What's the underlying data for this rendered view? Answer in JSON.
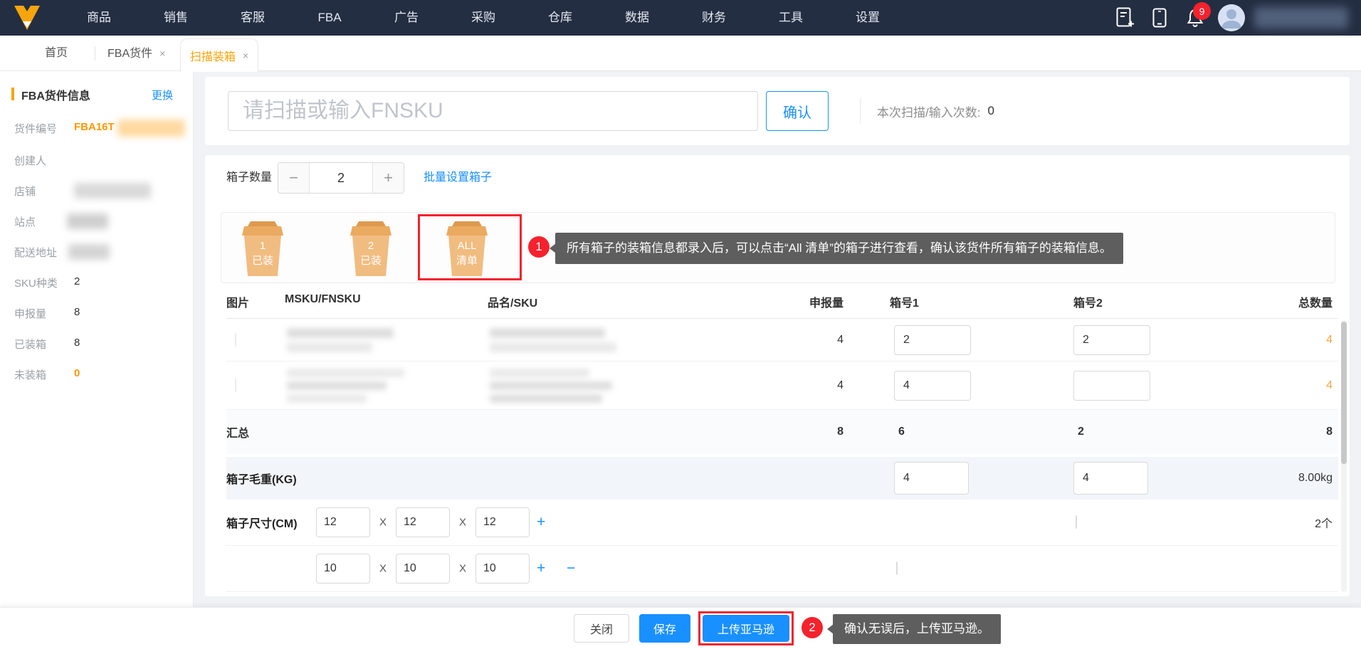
{
  "colors": {
    "accent_blue": "#1890ff",
    "brand_orange": "#f7a50d",
    "badge_red": "#f5222d",
    "navbar_bg": "#242e42",
    "tooltip_bg": "#5e5e5e"
  },
  "navbar": {
    "menu_items": [
      "商品",
      "销售",
      "客服",
      "FBA",
      "广告",
      "采购",
      "仓库",
      "数据",
      "财务",
      "工具",
      "设置"
    ],
    "notification_count": "9"
  },
  "tabs": [
    {
      "label": "首页"
    },
    {
      "label": "FBA货件",
      "close": "×"
    },
    {
      "label": "扫描装箱",
      "close": "×"
    }
  ],
  "sidebar": {
    "title": "FBA货件信息",
    "change_link": "更换",
    "fields": [
      {
        "label": "货件编号",
        "value": "FBA16T"
      },
      {
        "label": "创建人",
        "value": ""
      },
      {
        "label": "店铺",
        "value": ""
      },
      {
        "label": "站点",
        "value": ""
      },
      {
        "label": "配送地址",
        "value": ""
      },
      {
        "label": "SKU种类",
        "value": "2"
      },
      {
        "label": "申报量",
        "value": "8"
      },
      {
        "label": "已装箱",
        "value": "8"
      },
      {
        "label": "未装箱",
        "value": "0"
      }
    ]
  },
  "scan": {
    "placeholder": "请扫描或输入FNSKU",
    "confirm_label": "确认",
    "count_label": "本次扫描/输入次数:",
    "count_value": "0"
  },
  "box_controls": {
    "label": "箱子数量",
    "minus": "−",
    "value": "2",
    "plus": "+",
    "batch_link": "批量设置箱子"
  },
  "boxes": [
    {
      "line1": "1",
      "line2": "已装"
    },
    {
      "line1": "2",
      "line2": "已装"
    },
    {
      "line1": "ALL",
      "line2": "清单"
    }
  ],
  "callout_boxes": {
    "badge": "1",
    "text": "所有箱子的装箱信息都录入后，可以点击“All 清单”的箱子进行查看，确认该货件所有箱子的装箱信息。"
  },
  "table": {
    "headers": [
      "图片",
      "MSKU/FNSKU",
      "品名/SKU",
      "申报量",
      "箱号1",
      "箱号2",
      "总数量"
    ],
    "rows": [
      {
        "declared": "4",
        "box1": "2",
        "box2": "2",
        "total": "4"
      },
      {
        "declared": "4",
        "box1": "4",
        "box2": "",
        "total": "4"
      }
    ],
    "summary": {
      "label": "汇总",
      "declared": "8",
      "box1": "6",
      "box2": "2",
      "total": "8"
    },
    "weight": {
      "label": "箱子毛重(KG)",
      "box1": "4",
      "box2": "4",
      "total": "8.00kg"
    },
    "dimensions": {
      "label": "箱子尺寸(CM)",
      "x_separator": "X",
      "add_label": "+",
      "remove_label": "−",
      "rows": [
        {
          "l": "12",
          "w": "12",
          "h": "12",
          "box1_checked": true,
          "box2_checked": false,
          "count": "2个"
        },
        {
          "l": "10",
          "w": "10",
          "h": "10",
          "box1_checked": false,
          "box2_checked": true,
          "count": ""
        }
      ]
    }
  },
  "footer": {
    "close_label": "关闭",
    "save_label": "保存",
    "upload_label": "上传亚马逊",
    "callout": {
      "badge": "2",
      "text": "确认无误后，上传亚马逊。"
    }
  }
}
